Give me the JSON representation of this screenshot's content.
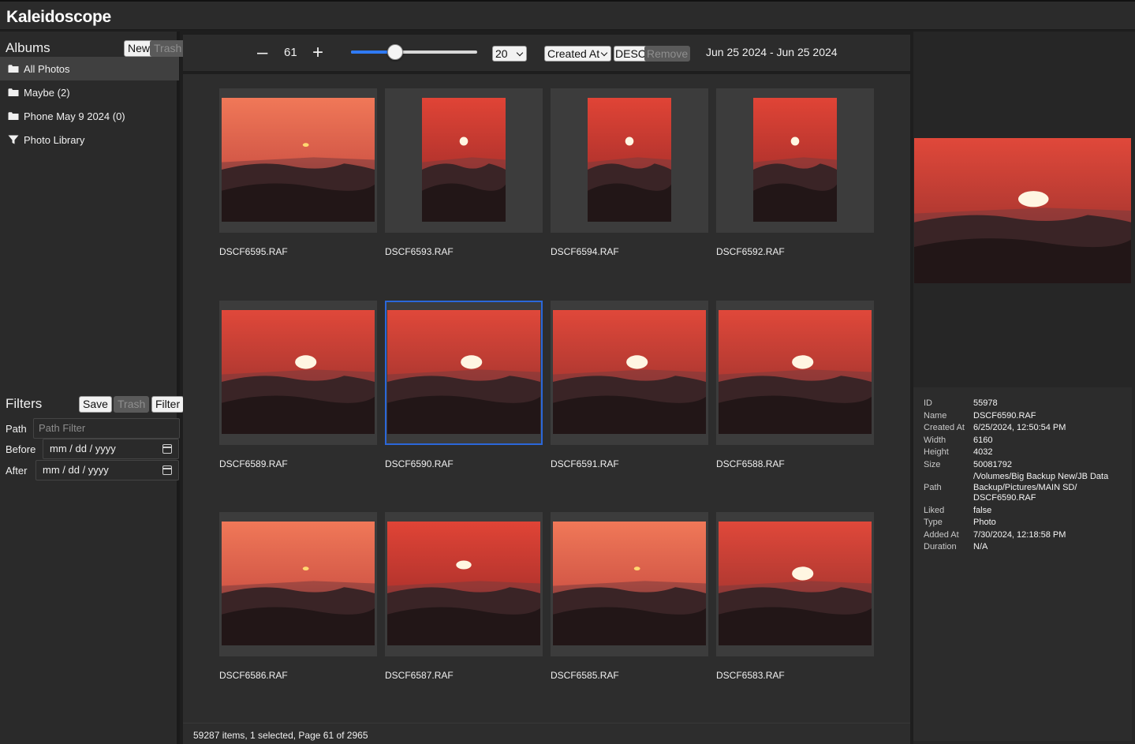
{
  "app": {
    "title": "Kaleidoscope"
  },
  "albums": {
    "title": "Albums",
    "new_label": "New",
    "trash_label": "Trash",
    "items": [
      {
        "label": "All Photos",
        "icon": "folder-icon",
        "active": true
      },
      {
        "label": "Maybe (2)",
        "icon": "folder-icon",
        "active": false
      },
      {
        "label": "Phone May 9 2024 (0)",
        "icon": "folder-icon",
        "active": false
      },
      {
        "label": "Photo Library",
        "icon": "filter-funnel-icon",
        "active": false
      }
    ]
  },
  "filters": {
    "title": "Filters",
    "save_label": "Save",
    "trash_label": "Trash",
    "filter_label": "Filter",
    "path_label": "Path",
    "path_placeholder": "Path Filter",
    "before_label": "Before",
    "before_value": "mm / dd / yyyy",
    "after_label": "After",
    "after_value": "mm / dd / yyyy"
  },
  "toolbar": {
    "minus_label": "–",
    "page": "61",
    "plus_label": "+",
    "zoom_fraction": 0.35,
    "per_page": "20",
    "sort_field": "Created At",
    "sort_order": "DESC",
    "remove_label": "Remove",
    "date_range": "Jun 25 2024 - Jun 25 2024"
  },
  "colors": {
    "accent": "#2f7af5",
    "selection": "#2b67d9"
  },
  "photos": [
    {
      "name": "DSCF6595.RAF",
      "orientation": "landscape",
      "variant": "haze"
    },
    {
      "name": "DSCF6593.RAF",
      "orientation": "portrait",
      "variant": "small-sun"
    },
    {
      "name": "DSCF6594.RAF",
      "orientation": "portrait",
      "variant": "small-sun"
    },
    {
      "name": "DSCF6592.RAF",
      "orientation": "portrait",
      "variant": "small-sun"
    },
    {
      "name": "DSCF6589.RAF",
      "orientation": "landscape",
      "variant": "big-sun"
    },
    {
      "name": "DSCF6590.RAF",
      "orientation": "landscape",
      "variant": "big-sun",
      "selected": true
    },
    {
      "name": "DSCF6591.RAF",
      "orientation": "landscape",
      "variant": "big-sun"
    },
    {
      "name": "DSCF6588.RAF",
      "orientation": "landscape",
      "variant": "big-sun"
    },
    {
      "name": "DSCF6586.RAF",
      "orientation": "landscape",
      "variant": "haze"
    },
    {
      "name": "DSCF6587.RAF",
      "orientation": "landscape",
      "variant": "small-sun"
    },
    {
      "name": "DSCF6585.RAF",
      "orientation": "landscape",
      "variant": "haze"
    },
    {
      "name": "DSCF6583.RAF",
      "orientation": "landscape",
      "variant": "big-sun"
    }
  ],
  "status": {
    "text": "59287 items, 1 selected, Page 61 of 2965"
  },
  "info": [
    {
      "key": "ID",
      "value": "55978"
    },
    {
      "key": "Name",
      "value": "DSCF6590.RAF"
    },
    {
      "key": "Created At",
      "value": "6/25/2024, 12:50:54 PM"
    },
    {
      "key": "Width",
      "value": "6160"
    },
    {
      "key": "Height",
      "value": "4032"
    },
    {
      "key": "Size",
      "value": "50081792"
    },
    {
      "key": "Path",
      "value": "/Volumes/Big Backup New/JB Data Backup/Pictures/MAIN SD/ DSCF6590.RAF"
    },
    {
      "key": "Liked",
      "value": "false"
    },
    {
      "key": "Type",
      "value": "Photo"
    },
    {
      "key": "Added At",
      "value": "7/30/2024, 12:18:58 PM"
    },
    {
      "key": "Duration",
      "value": "N/A"
    }
  ]
}
